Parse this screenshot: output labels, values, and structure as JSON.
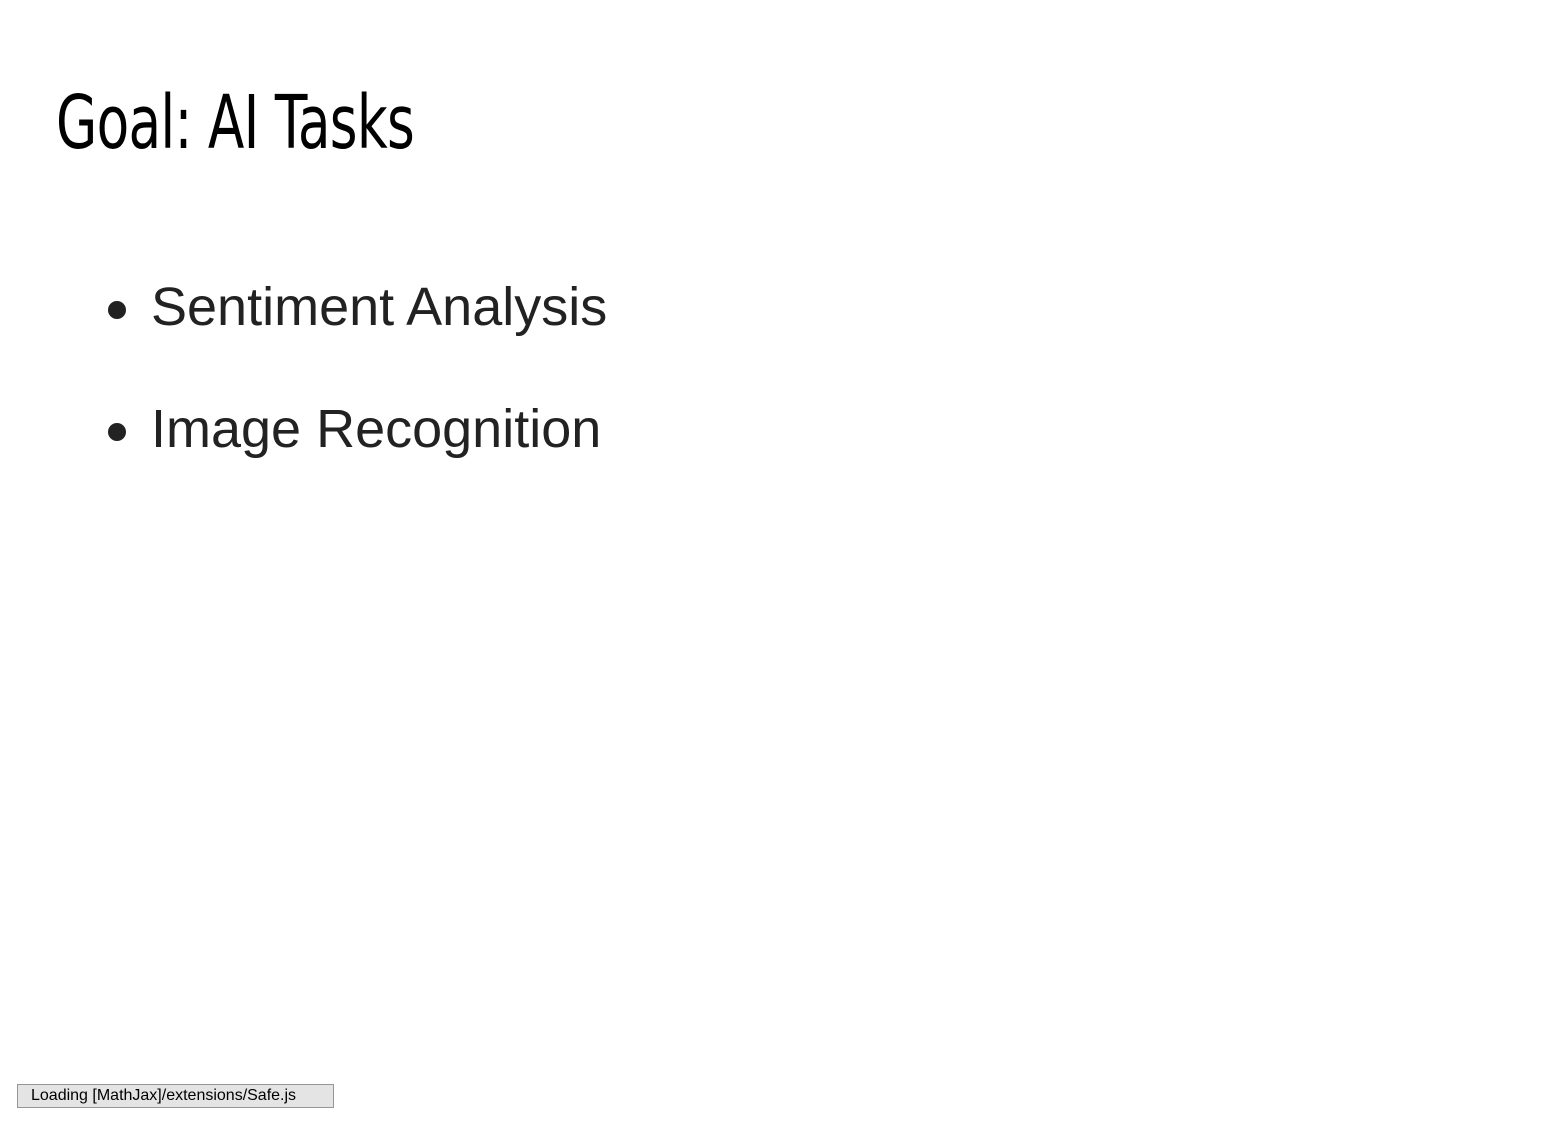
{
  "slide": {
    "title": "Goal: AI Tasks",
    "bullets": [
      "Sentiment Analysis",
      "Image Recognition"
    ]
  },
  "status": {
    "message": "Loading [MathJax]/extensions/Safe.js"
  },
  "colors": {
    "title": "#000000",
    "body_text": "#222222",
    "status_background": "#e4e4e4",
    "status_border": "#959595"
  }
}
